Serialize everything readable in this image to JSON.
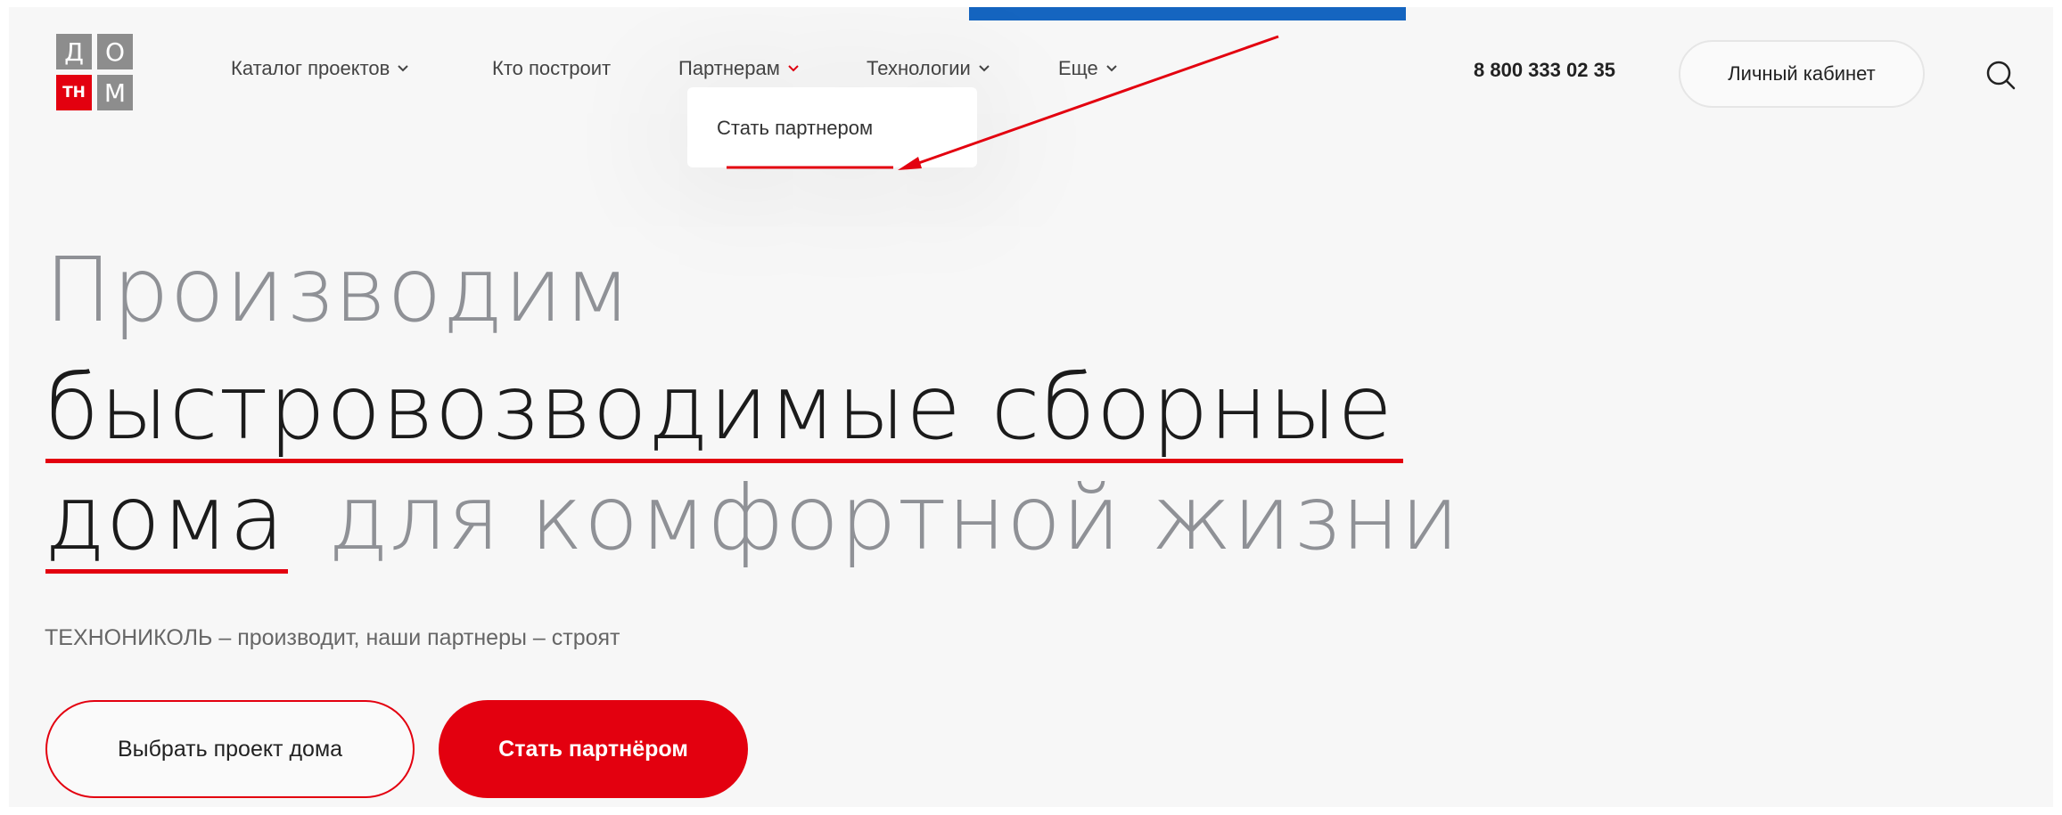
{
  "header": {
    "logo": {
      "letters": [
        "Д",
        "О",
        "ТН",
        "М"
      ]
    },
    "nav": [
      {
        "label": "Каталог проектов",
        "has_dropdown": true
      },
      {
        "label": "Кто построит",
        "has_dropdown": false
      },
      {
        "label": "Партнерам",
        "has_dropdown": true,
        "active": true
      },
      {
        "label": "Технологии",
        "has_dropdown": true
      },
      {
        "label": "Еще",
        "has_dropdown": true
      }
    ],
    "phone": "8 800 333 02 35",
    "account_label": "Личный кабинет",
    "search_icon": "search-icon"
  },
  "dropdown": {
    "items": [
      "Стать партнером"
    ]
  },
  "hero": {
    "line1": "Производим",
    "line2": "быстровозводимые сборные",
    "line3_dark": "дома",
    "line3_gray": "для комфортной жизни",
    "subtitle": "ТЕХНОНИКОЛЬ – производит, наши партнеры – строят",
    "btn_primary": "Выбрать проект дома",
    "btn_secondary": "Стать партнёром"
  },
  "colors": {
    "accent_red": "#e3000f",
    "highlight_blue": "#1565c0",
    "logo_gray": "#8d8d8d"
  }
}
